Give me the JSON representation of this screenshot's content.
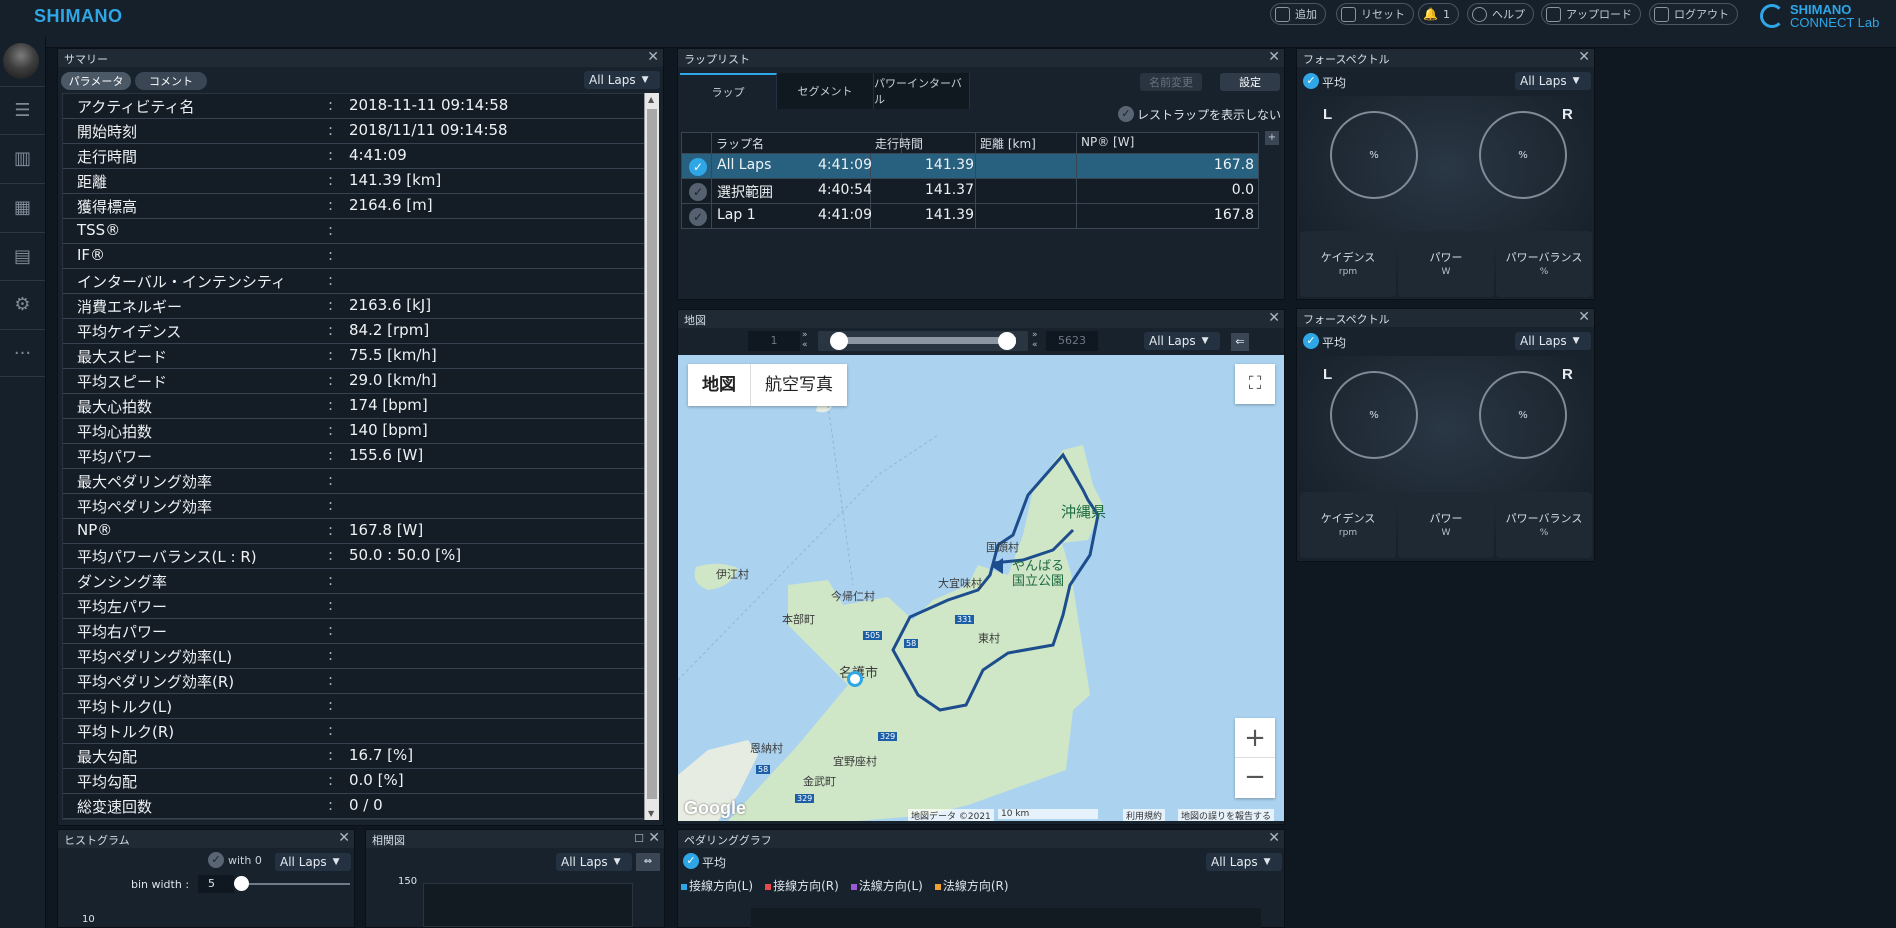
{
  "app": {
    "logo": "SHIMANO",
    "brand_line1": "SHIMANO",
    "brand_line2": "CONNECT Lab"
  },
  "toolbar": {
    "add": "追加",
    "reset": "リセット",
    "notifications_count": "1",
    "help": "ヘルプ",
    "upload": "アップロード",
    "logout": "ログアウト"
  },
  "summary": {
    "title": "サマリー",
    "tab_params": "パラメータ",
    "tab_comments": "コメント",
    "laps_select": "All Laps",
    "rows": [
      {
        "k": "アクティビティ名",
        "v": "2018-11-11 09:14:58"
      },
      {
        "k": "開始時刻",
        "v": "2018/11/11 09:14:58"
      },
      {
        "k": "走行時間",
        "v": "4:41:09"
      },
      {
        "k": "距離",
        "v": "141.39 [km]"
      },
      {
        "k": "獲得標高",
        "v": "2164.6 [m]"
      },
      {
        "k": "TSS®",
        "v": ""
      },
      {
        "k": "IF®",
        "v": ""
      },
      {
        "k": "インターバル・インテンシティ",
        "v": ""
      },
      {
        "k": "消費エネルギー",
        "v": "2163.6 [kJ]"
      },
      {
        "k": "平均ケイデンス",
        "v": "84.2 [rpm]"
      },
      {
        "k": "最大スピード",
        "v": "75.5 [km/h]"
      },
      {
        "k": "平均スピード",
        "v": "29.0 [km/h]"
      },
      {
        "k": "最大心拍数",
        "v": "174 [bpm]"
      },
      {
        "k": "平均心拍数",
        "v": "140 [bpm]"
      },
      {
        "k": "平均パワー",
        "v": "155.6 [W]"
      },
      {
        "k": "最大ペダリング効率",
        "v": ""
      },
      {
        "k": "平均ペダリング効率",
        "v": ""
      },
      {
        "k": "NP®",
        "v": "167.8 [W]"
      },
      {
        "k": "平均パワーバランス(L : R)",
        "v": "50.0 : 50.0 [%]"
      },
      {
        "k": "ダンシング率",
        "v": ""
      },
      {
        "k": "平均左パワー",
        "v": ""
      },
      {
        "k": "平均右パワー",
        "v": ""
      },
      {
        "k": "平均ペダリング効率(L)",
        "v": ""
      },
      {
        "k": "平均ペダリング効率(R)",
        "v": ""
      },
      {
        "k": "平均トルク(L)",
        "v": ""
      },
      {
        "k": "平均トルク(R)",
        "v": ""
      },
      {
        "k": "最大勾配",
        "v": "16.7 [%]"
      },
      {
        "k": "平均勾配",
        "v": "0.0 [%]"
      },
      {
        "k": "総変速回数",
        "v": "0 / 0"
      }
    ]
  },
  "laplist": {
    "title": "ラップリスト",
    "tabs": [
      "ラップ",
      "セグメント",
      "パワーインターバル"
    ],
    "rename": "名前変更",
    "settings": "設定",
    "rest_toggle": "レストラップを表示しない",
    "headers": [
      "ラップ名",
      "走行時間",
      "距離 [km]",
      "NP® [W]"
    ],
    "rows": [
      {
        "name": "All Laps",
        "time": "4:41:09",
        "dist": "141.39",
        "np": "167.8"
      },
      {
        "name": "選択範囲",
        "time": "4:40:54",
        "dist": "141.37",
        "np": "0.0"
      },
      {
        "name": "Lap 1",
        "time": "4:41:09",
        "dist": "141.39",
        "np": "167.8"
      }
    ]
  },
  "force1": {
    "title": "フォースペクトル",
    "avg": "平均",
    "laps": "All Laps",
    "L": "L",
    "R": "R",
    "pct": "%",
    "cadence": "ケイデンス",
    "cadence_u": "rpm",
    "power": "パワー",
    "power_u": "W",
    "balance": "パワーバランス",
    "balance_u": "%"
  },
  "force2": {
    "title": "フォースペクトル",
    "avg": "平均",
    "laps": "All Laps",
    "L": "L",
    "R": "R",
    "pct": "%",
    "cadence": "ケイデンス",
    "cadence_u": "rpm",
    "power": "パワー",
    "power_u": "W",
    "balance": "パワーバランス",
    "balance_u": "%"
  },
  "mappanel": {
    "title": "地図",
    "start": "1",
    "end": "5623",
    "laps": "All Laps",
    "tab_map": "地図",
    "tab_sat": "航空写真",
    "labels": [
      "沖縄県",
      "国頭村",
      "やんばる",
      "国立公園",
      "伊江村",
      "今帰仁村",
      "本部町",
      "名護市",
      "大宜味村",
      "東村",
      "恩納村",
      "宜野座村",
      "金武町"
    ],
    "roads": [
      "505",
      "58",
      "331",
      "329",
      "329",
      "58"
    ],
    "google": "Google",
    "footer_data": "地図データ ©2021",
    "footer_scale": "10 km",
    "footer_terms": "利用規約",
    "footer_report": "地図の誤りを報告する",
    "zoom_in": "+",
    "zoom_out": "−"
  },
  "histogram": {
    "title": "ヒストグラム",
    "with0": "with 0",
    "laps": "All Laps",
    "bin_label": "bin width :",
    "bin_value": "5",
    "yval": "10"
  },
  "correlation": {
    "title": "相関図",
    "laps": "All Laps",
    "yval": "150"
  },
  "pedaling": {
    "title": "ペダリンググラフ",
    "avg": "平均",
    "laps": "All Laps",
    "legend": [
      "接線方向(L)",
      "接線方向(R)",
      "法線方向(L)",
      "法線方向(R)"
    ],
    "legend_colors": [
      "#2fa6e6",
      "#e64a4a",
      "#9b59d6",
      "#f0a030"
    ]
  }
}
